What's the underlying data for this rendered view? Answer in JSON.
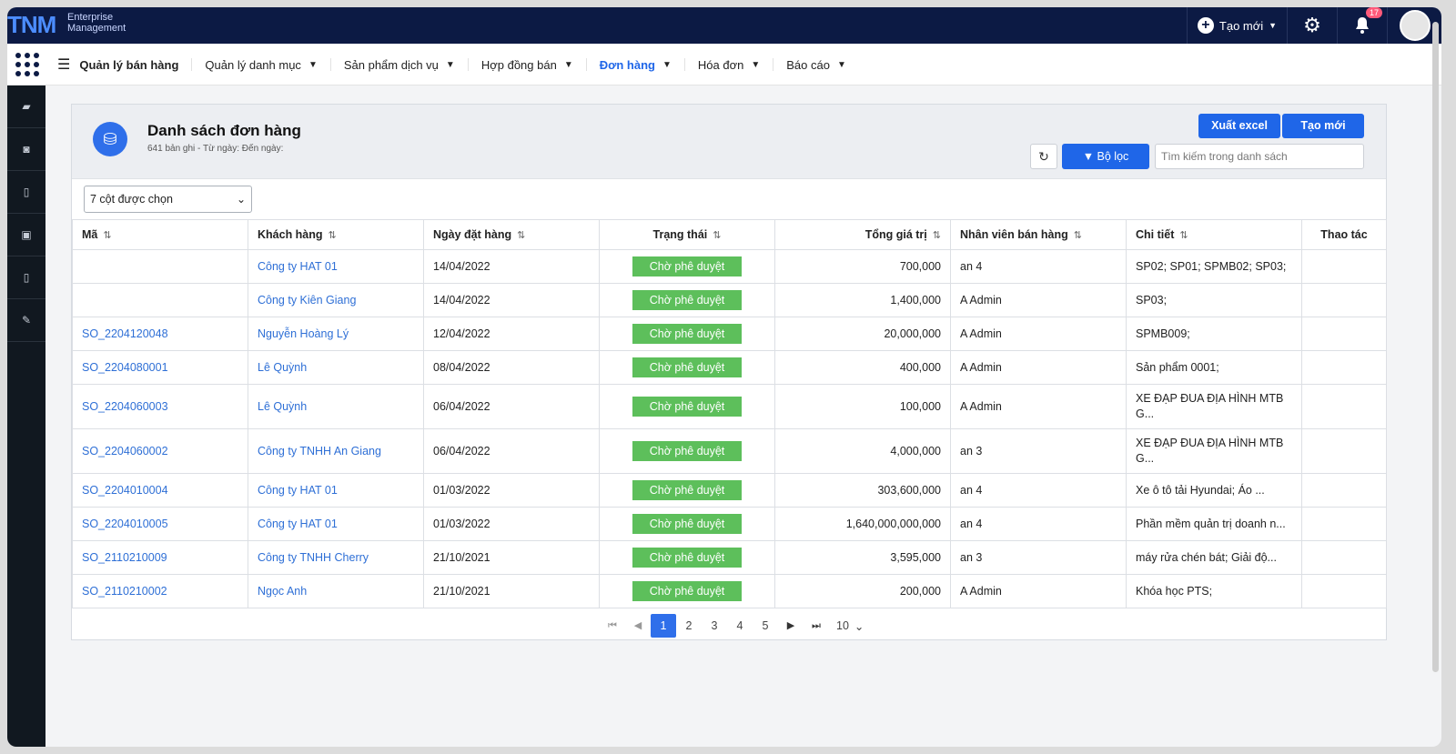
{
  "topbar": {
    "logo": "TNM",
    "logo_sub_1": "Enterprise",
    "logo_sub_2": "Management",
    "new_label": "Tạo mới",
    "notification_count": "17"
  },
  "nav": {
    "brand": "Quản lý bán hàng",
    "items": [
      {
        "label": "Quản lý danh mục"
      },
      {
        "label": "Sản phẩm dịch vụ"
      },
      {
        "label": "Hợp đồng bán"
      },
      {
        "label": "Đơn hàng"
      },
      {
        "label": "Hóa đơn"
      },
      {
        "label": "Báo cáo"
      }
    ]
  },
  "sidebar": {
    "icons": [
      "book-icon",
      "binoculars-icon",
      "document-icon",
      "money-document-icon",
      "file-icon",
      "edit-icon"
    ]
  },
  "page": {
    "title": "Danh sách đơn hàng",
    "subtitle": "641 bản ghi - Từ ngày: Đến ngày:",
    "export_label": "Xuất excel",
    "create_label": "Tạo mới",
    "filter_label": "Bộ lọc",
    "search_placeholder": "Tìm kiếm trong danh sách",
    "column_select": "7 cột được chọn"
  },
  "table": {
    "headers": [
      "Mã",
      "Khách hàng",
      "Ngày đặt hàng",
      "Trạng thái",
      "Tổng giá trị",
      "Nhân viên bán hàng",
      "Chi tiết",
      "Thao tác"
    ],
    "rows": [
      {
        "code": "",
        "customer": "Công ty HAT 01",
        "date": "14/04/2022",
        "status": "Chờ phê duyệt",
        "total": "700,000",
        "staff": "an 4",
        "detail": "SP02; SP01; SPMB02; SP03;"
      },
      {
        "code": "",
        "customer": "Công ty Kiên Giang",
        "date": "14/04/2022",
        "status": "Chờ phê duyệt",
        "total": "1,400,000",
        "staff": "A Admin",
        "detail": "SP03;"
      },
      {
        "code": "SO_2204120048",
        "customer": "Nguyễn Hoàng Lý",
        "date": "12/04/2022",
        "status": "Chờ phê duyệt",
        "total": "20,000,000",
        "staff": "A Admin",
        "detail": "SPMB009;"
      },
      {
        "code": "SO_2204080001",
        "customer": "Lê Quỳnh",
        "date": "08/04/2022",
        "status": "Chờ phê duyệt",
        "total": "400,000",
        "staff": "A Admin",
        "detail": "Sản phẩm 0001;"
      },
      {
        "code": "SO_2204060003",
        "customer": "Lê Quỳnh",
        "date": "06/04/2022",
        "status": "Chờ phê duyệt",
        "total": "100,000",
        "staff": "A Admin",
        "detail": "XE ĐẠP ĐUA ĐỊA HÌNH MTB G..."
      },
      {
        "code": "SO_2204060002",
        "customer": "Công ty TNHH An Giang",
        "date": "06/04/2022",
        "status": "Chờ phê duyệt",
        "total": "4,000,000",
        "staff": "an 3",
        "detail": "XE ĐẠP ĐUA ĐỊA HÌNH MTB G..."
      },
      {
        "code": "SO_2204010004",
        "customer": "Công ty HAT 01",
        "date": "01/03/2022",
        "status": "Chờ phê duyệt",
        "total": "303,600,000",
        "staff": "an 4",
        "detail": "Xe ô tô tải Hyundai; Áo ..."
      },
      {
        "code": "SO_2204010005",
        "customer": "Công ty HAT 01",
        "date": "01/03/2022",
        "status": "Chờ phê duyệt",
        "total": "1,640,000,000,000",
        "staff": "an 4",
        "detail": "Phần mềm quản trị doanh n..."
      },
      {
        "code": "SO_2110210009",
        "customer": "Công ty TNHH Cherry",
        "date": "21/10/2021",
        "status": "Chờ phê duyệt",
        "total": "3,595,000",
        "staff": "an 3",
        "detail": "máy rửa chén bát; Giải độ..."
      },
      {
        "code": "SO_2110210002",
        "customer": "Ngọc Anh",
        "date": "21/10/2021",
        "status": "Chờ phê duyệt",
        "total": "200,000",
        "staff": "A Admin",
        "detail": "Khóa học PTS;"
      }
    ]
  },
  "pagination": {
    "pages": [
      "1",
      "2",
      "3",
      "4",
      "5"
    ],
    "current": "1",
    "page_size": "10"
  },
  "colors": {
    "topbar": "#0c1a44",
    "primary": "#1f66e8",
    "status_green": "#5dbf5b",
    "link": "#2e6fd6"
  }
}
